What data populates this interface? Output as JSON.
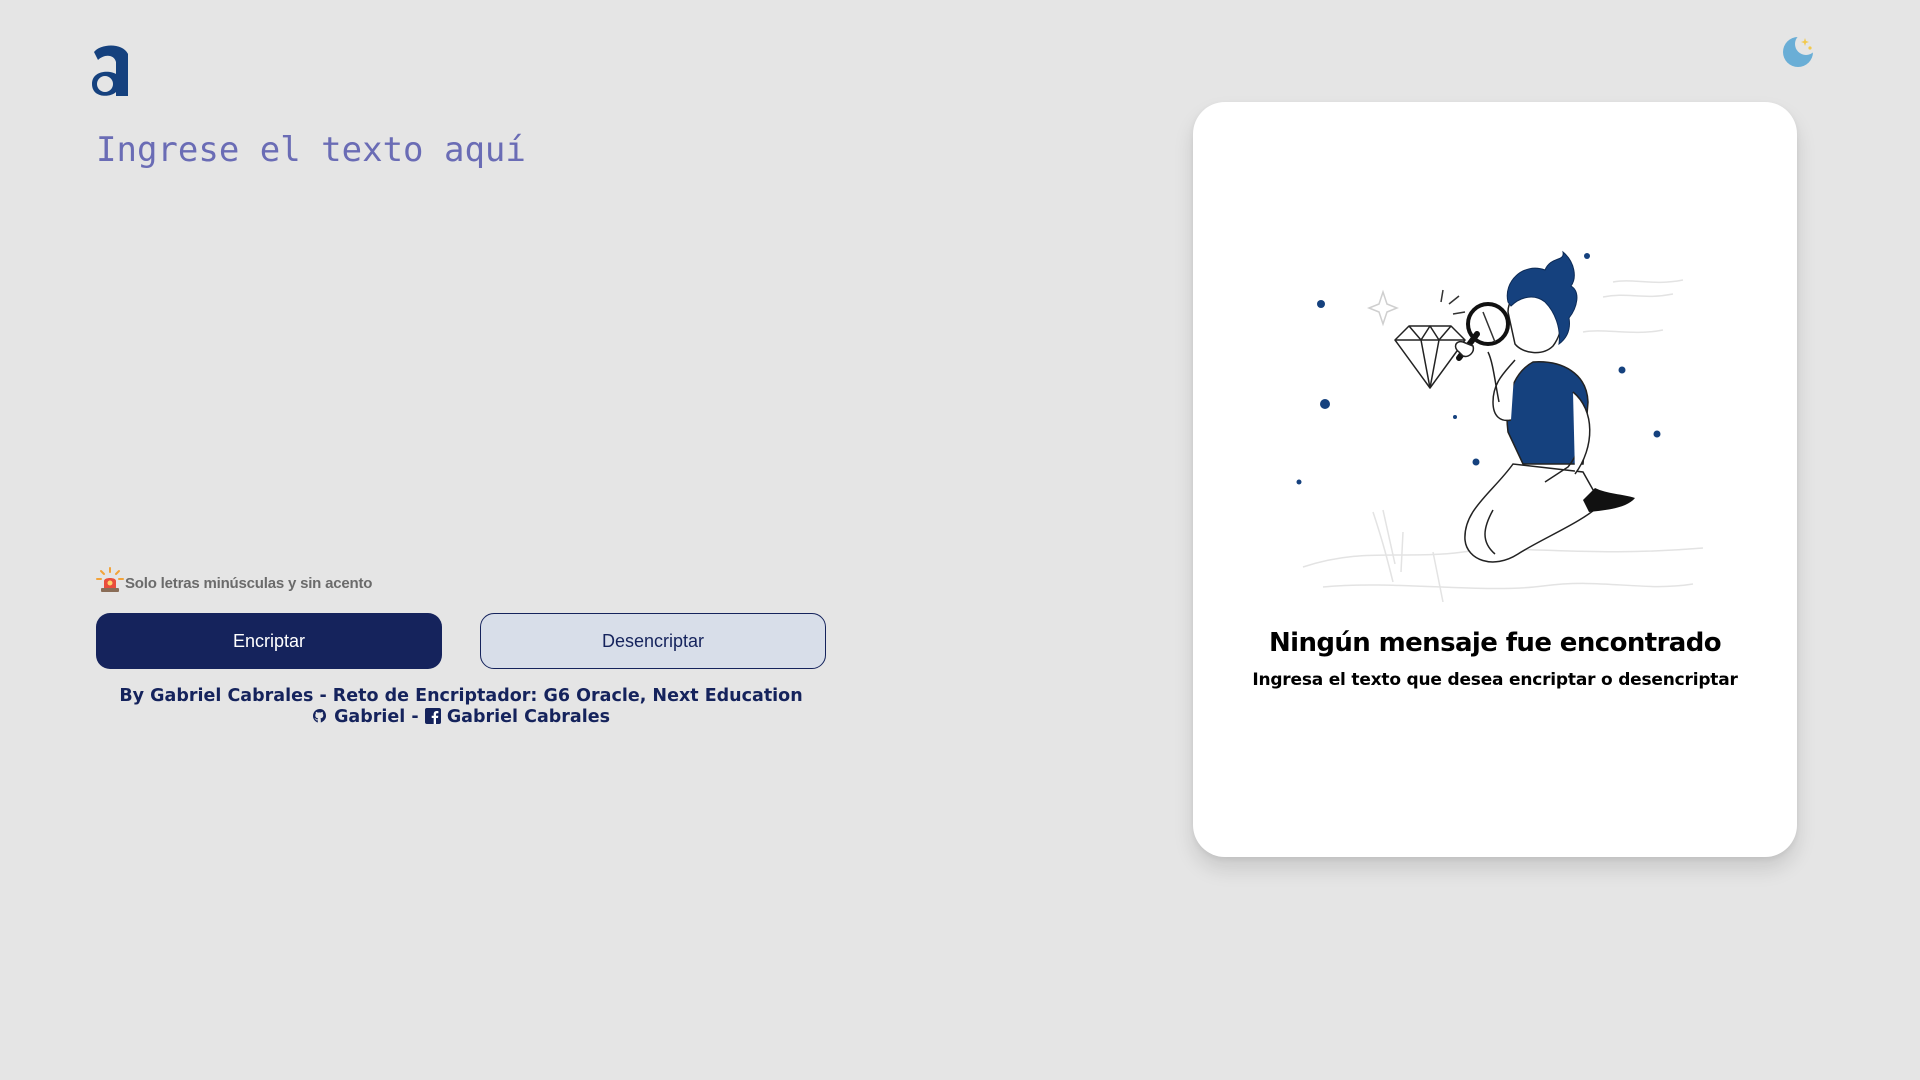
{
  "app": {
    "logo_icon": "letter-a-logo",
    "theme_toggle_icon": "moon-icon",
    "colors": {
      "background": "#e5e5e5",
      "primary": "#15235c",
      "accent": "#0a3871",
      "placeholder": "#6a6cb5",
      "card": "#ffffff"
    }
  },
  "input": {
    "placeholder": "Ingrese el texto aquí",
    "value": ""
  },
  "hint": {
    "icon": "alarm-light-icon",
    "text": "Solo letras minúsculas y sin acento"
  },
  "buttons": {
    "encrypt_label": "Encriptar",
    "decrypt_label": "Desencriptar"
  },
  "footer": {
    "credits": "By Gabriel Cabrales - Reto de Encriptador: G6 Oracle, Next Education",
    "github_icon": "github-icon",
    "github_label": "Gabriel",
    "separator": "-",
    "facebook_icon": "facebook-icon",
    "facebook_label": "Gabriel Cabrales"
  },
  "output_card": {
    "illustration": "person-with-magnifying-glass-diamond",
    "title": "Ningún mensaje fue encontrado",
    "subtitle": "Ingresa el texto que desea encriptar o desencriptar"
  }
}
